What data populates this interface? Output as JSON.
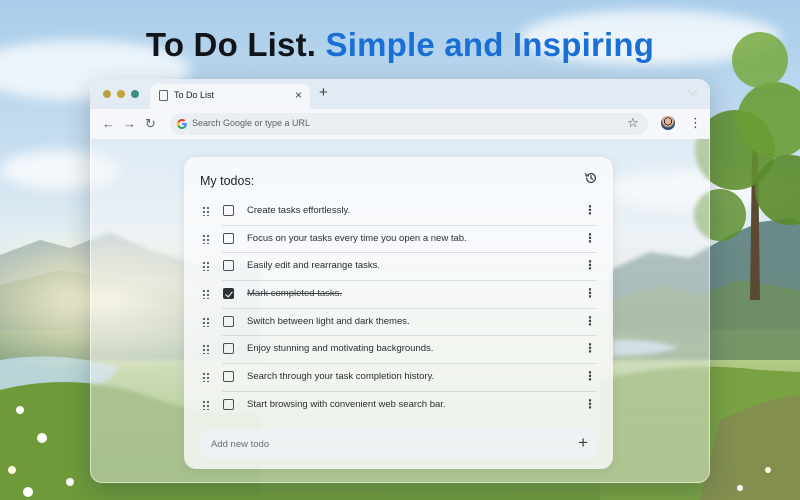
{
  "headline": {
    "part1": "To Do List.",
    "part2": "Simple and Inspiring"
  },
  "browser": {
    "tab_title": "To Do List",
    "tab_close": "×",
    "new_tab": "+",
    "omnibox_placeholder": "Search Google or type a URL",
    "nav": {
      "back": "←",
      "forward": "→",
      "reload": "↻"
    },
    "star": "☆",
    "menu": "⋮"
  },
  "todo": {
    "title": "My todos:",
    "items": [
      {
        "text": "Create tasks effortlessly.",
        "done": false
      },
      {
        "text": "Focus on your tasks every time you open a new tab.",
        "done": false
      },
      {
        "text": "Easily edit and rearrange tasks.",
        "done": false
      },
      {
        "text": "Mark completed tasks.",
        "done": true
      },
      {
        "text": "Switch between light and dark themes.",
        "done": false
      },
      {
        "text": "Enjoy stunning and motivating backgrounds.",
        "done": false
      },
      {
        "text": "Search through your task completion history.",
        "done": false
      },
      {
        "text": "Start browsing with convenient web search bar.",
        "done": false
      }
    ],
    "item_menu": "⋮",
    "add_placeholder": "Add new todo",
    "add_button": "+"
  },
  "colors": {
    "headline_dark": "#111418",
    "headline_accent": "#1a6fd6",
    "checkbox_checked": "#2f3338"
  },
  "icons": [
    "page-icon",
    "google-g-icon",
    "history-icon",
    "drag-handle-icon",
    "kebab-menu-icon",
    "plus-icon",
    "star-icon",
    "avatar"
  ]
}
